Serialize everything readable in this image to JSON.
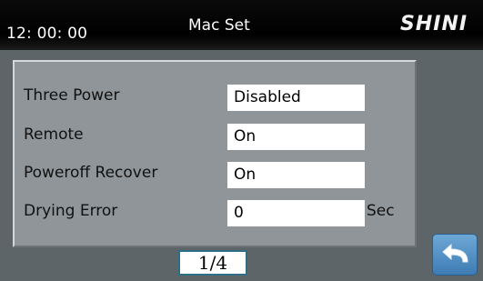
{
  "header": {
    "clock": "12: 00: 00",
    "title": "Mac Set",
    "logo": "SHINI"
  },
  "settings": [
    {
      "label": "Three Power",
      "value": "Disabled",
      "unit": ""
    },
    {
      "label": "Remote",
      "value": "On",
      "unit": ""
    },
    {
      "label": "Poweroff Recover",
      "value": "On",
      "unit": ""
    },
    {
      "label": "Drying Error",
      "value": "0",
      "unit": "Sec"
    }
  ],
  "pager": {
    "text": "1/4"
  },
  "footer": {
    "back_icon": "return-arrow-icon"
  },
  "colors": {
    "background": "#5e6569",
    "panel": "#8f9599",
    "header": "#000000",
    "back_button": "#4f8fc4"
  }
}
